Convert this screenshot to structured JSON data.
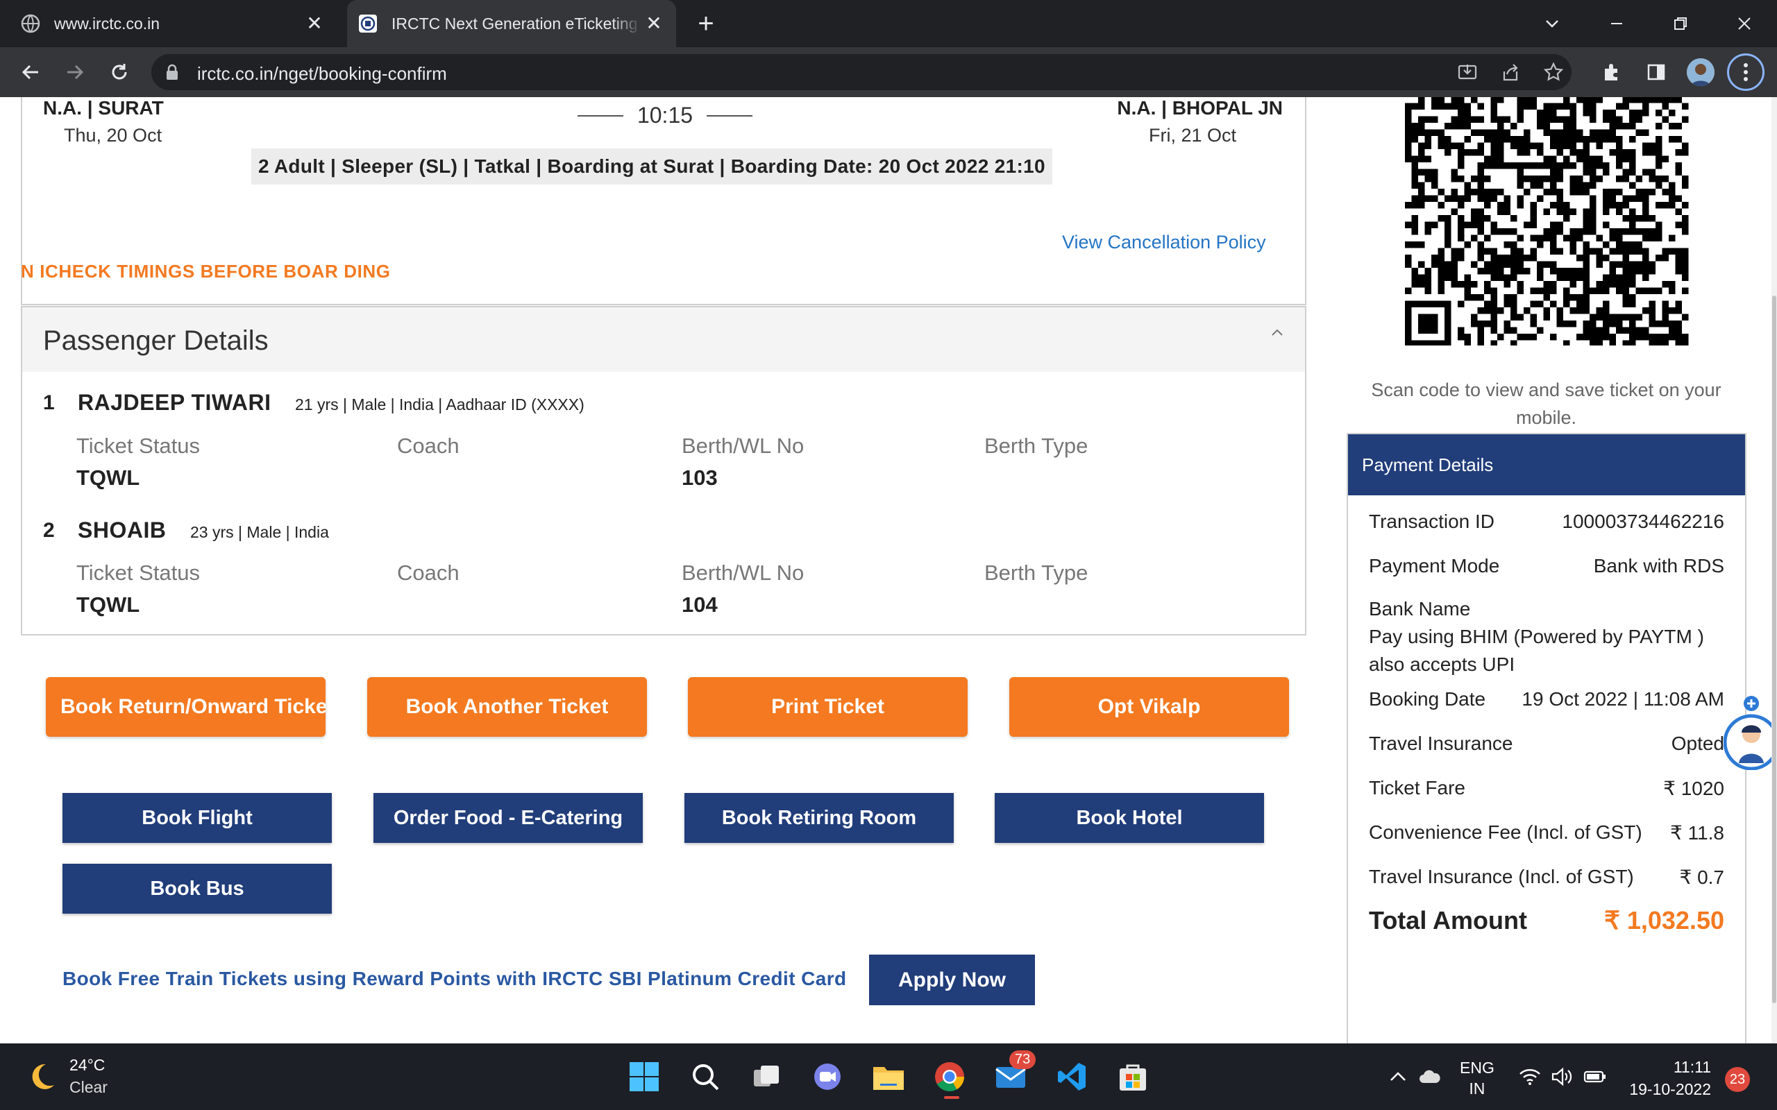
{
  "browser": {
    "tabs": [
      {
        "title": "www.irctc.co.in",
        "active": false
      },
      {
        "title": "IRCTC Next Generation eTicketing",
        "active": true
      }
    ],
    "url": "irctc.co.in/nget/booking-confirm"
  },
  "journey": {
    "from_station": "N.A. | SURAT",
    "from_date": "Thu, 20 Oct",
    "to_station": "N.A. | BHOPAL JN",
    "to_date": "Fri, 21 Oct",
    "duration": "10:15",
    "class_info": "2 Adult | Sleeper (SL) | Tatkal | Boarding at Surat | Boarding Date: 20 Oct 2022 21:10"
  },
  "cancellation_link": "View Cancellation Policy",
  "warning": "N ICHECK TIMINGS BEFORE BOAR DING",
  "passengers": {
    "heading": "Passenger Details",
    "column_labels": {
      "status": "Ticket Status",
      "coach": "Coach",
      "berth_no": "Berth/WL No",
      "berth_type": "Berth Type"
    },
    "list": [
      {
        "no": "1",
        "name": "RAJDEEP TIWARI",
        "meta": "21 yrs | Male | India | Aadhaar ID (XXXX)",
        "status": "TQWL",
        "coach": "",
        "berth_no": "103",
        "berth_type": ""
      },
      {
        "no": "2",
        "name": "SHOAIB",
        "meta": "23 yrs | Male | India",
        "status": "TQWL",
        "coach": "",
        "berth_no": "104",
        "berth_type": ""
      }
    ]
  },
  "actions": {
    "book_return": "Book Return/Onward Ticket",
    "book_another": "Book Another Ticket",
    "print": "Print Ticket",
    "vikalp": "Opt Vikalp"
  },
  "services": {
    "flight": "Book Flight",
    "food": "Order Food - E-Catering",
    "retiring": "Book Retiring Room",
    "hotel": "Book Hotel",
    "bus": "Book Bus"
  },
  "promo": {
    "text": "Book Free Train Tickets using Reward Points with IRCTC SBI Platinum Credit Card",
    "button": "Apply Now"
  },
  "qr": {
    "caption": "Scan code to view and save ticket on your mobile."
  },
  "payment": {
    "heading": "Payment Details",
    "transaction_label": "Transaction ID",
    "transaction_value": "100003734462216",
    "mode_label": "Payment Mode",
    "mode_value": "Bank with RDS",
    "bank_label": "Bank Name",
    "bank_value": "Pay using BHIM (Powered by PAYTM ) also accepts UPI",
    "booking_date_label": "Booking Date",
    "booking_date_value": "19 Oct 2022 | 11:08 AM",
    "insurance_label": "Travel Insurance",
    "insurance_value": "Opted",
    "fare_label": "Ticket Fare",
    "fare_value": "₹ 1020",
    "conv_label": "Convenience Fee (Incl. of GST)",
    "conv_value": "₹ 11.8",
    "ins_fee_label": "Travel Insurance (Incl. of GST)",
    "ins_fee_value": "₹ 0.7",
    "total_label": "Total Amount",
    "total_value": "₹ 1,032.50"
  },
  "taskbar": {
    "temperature": "24°C",
    "condition": "Clear",
    "mail_badge": "73",
    "lang_1": "ENG",
    "lang_2": "IN",
    "time": "11:11",
    "date": "19-10-2022",
    "notifications": "23"
  },
  "colors": {
    "orange": "#f47920",
    "navy": "#213d7a",
    "link_blue": "#2474c4"
  }
}
